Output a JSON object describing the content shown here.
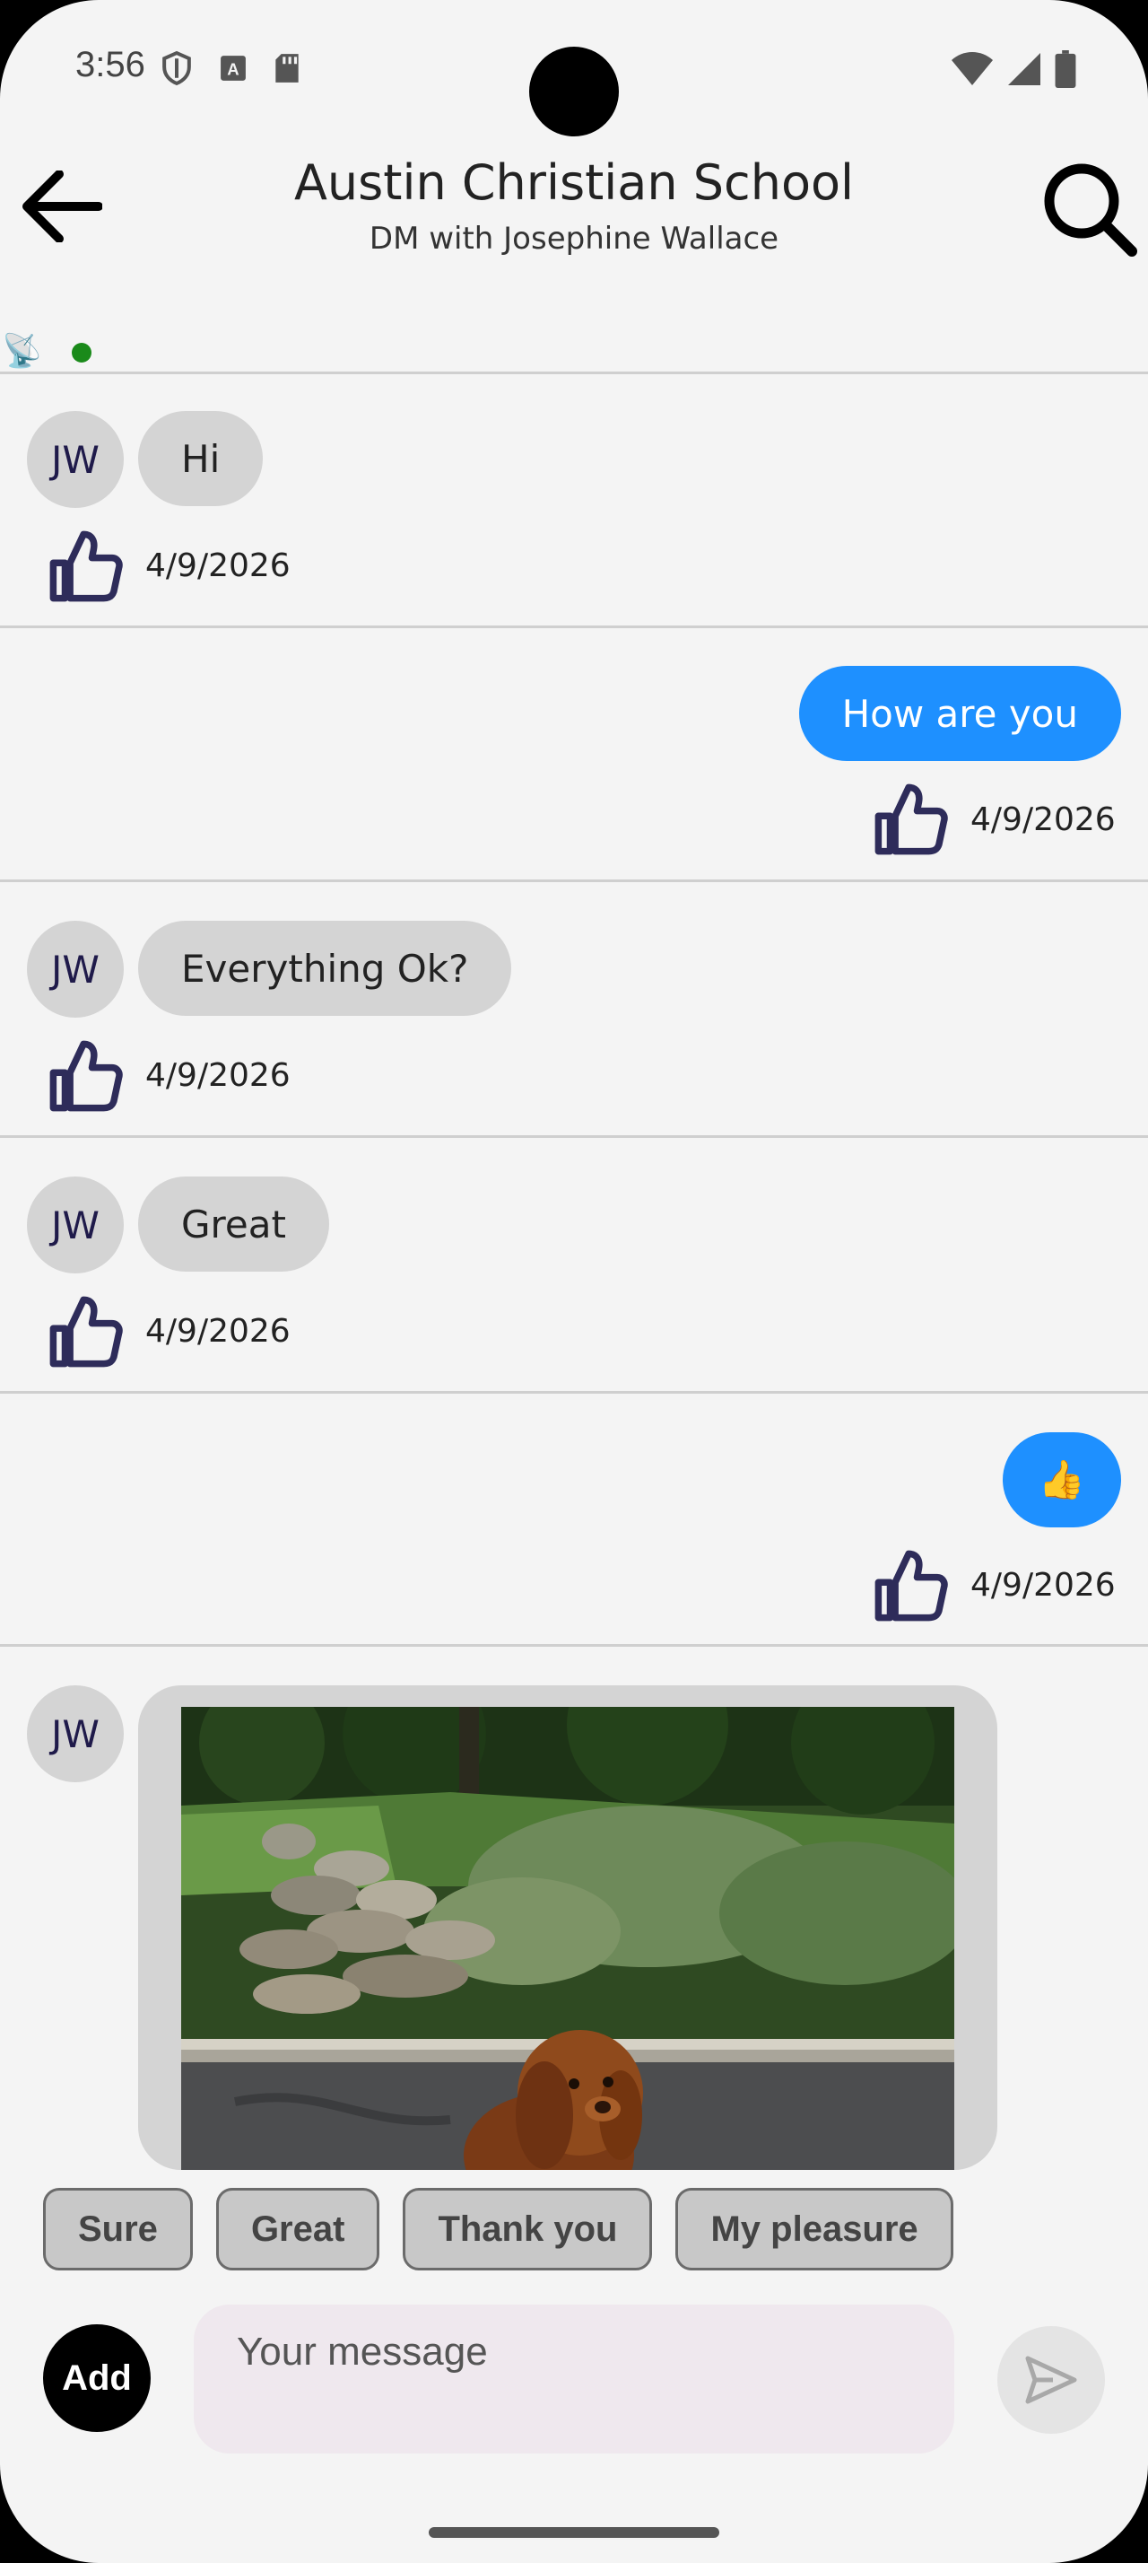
{
  "status_bar": {
    "time": "3:56"
  },
  "header": {
    "title": "Austin Christian School",
    "subtitle": "DM with Josephine Wallace"
  },
  "messages": [
    {
      "sender_initials": "JW",
      "text": "Hi",
      "date": "4/9/2026"
    },
    {
      "text": "How are you",
      "date": "4/9/2026"
    },
    {
      "sender_initials": "JW",
      "text": "Everything Ok?",
      "date": "4/9/2026"
    },
    {
      "sender_initials": "JW",
      "text": "Great",
      "date": "4/9/2026"
    },
    {
      "text": "👍",
      "date": "4/9/2026"
    },
    {
      "sender_initials": "JW"
    }
  ],
  "quick_replies": [
    "Sure",
    "Great",
    "Thank you",
    "My pleasure"
  ],
  "composer": {
    "add_label": "Add",
    "placeholder": "Your message"
  },
  "colors": {
    "outgoing_bubble": "#1e90ff",
    "incoming_bubble": "#d4d4d4",
    "like_icon": "#2e2c5a",
    "online": "#1a8a1a"
  },
  "icons": [
    "back-arrow-icon",
    "search-icon",
    "antenna-icon",
    "thumbs-up-icon",
    "send-icon"
  ]
}
